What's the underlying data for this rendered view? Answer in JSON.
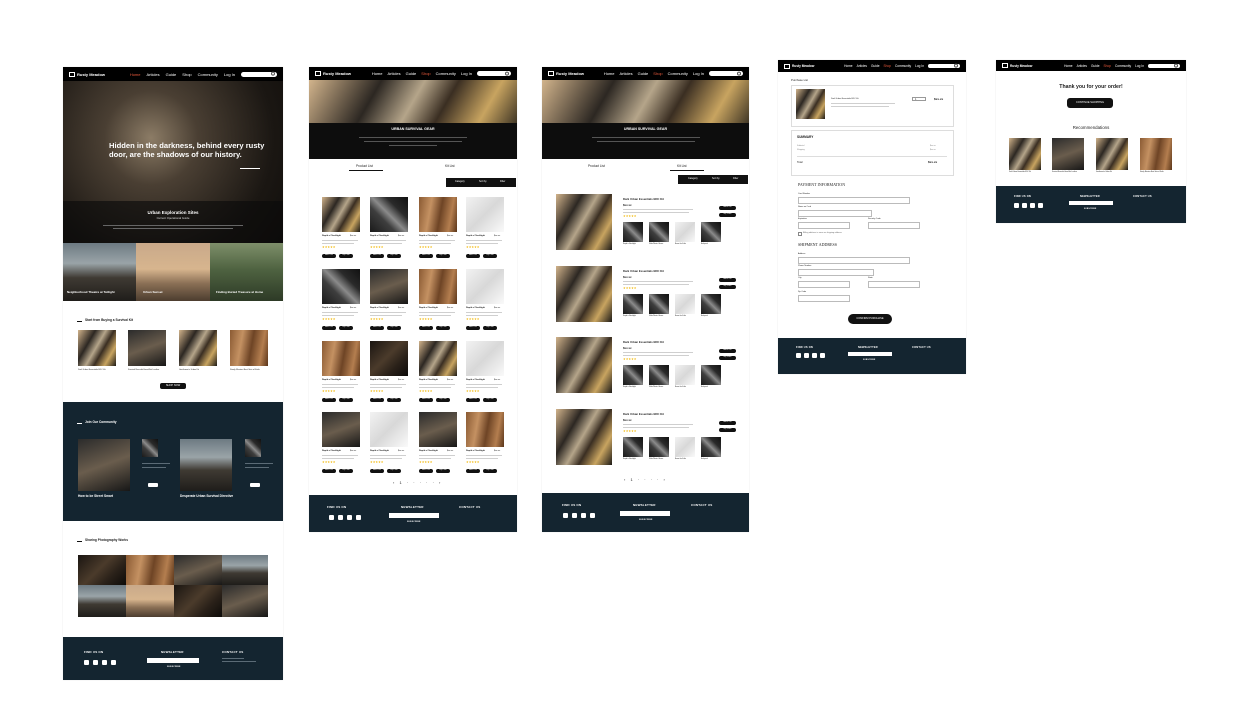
{
  "brand": "Rusty Meadow",
  "nav": [
    "Home",
    "Articles",
    "Guide",
    "Shop",
    "Community",
    "Log In"
  ],
  "home": {
    "hero_text": "Hidden in the darkness, behind every rusty door, are the shadows of our history.",
    "explore_title": "Urban Exploration Sites",
    "explore_sub": "Current Operational Guide",
    "cards": [
      "Neighborhood Theatre at Twilight",
      "Urban Sunset",
      "Finding Buried Treasure at Home"
    ],
    "survival_title": "Start from Buying a Survival Kit",
    "kits": [
      "Dark Urban Essentials EDC Kit",
      "Survival Bracelet Hand-Set Leather",
      "Gentleman's Urbex Kit",
      "Steely Masters Best Sets of Knife"
    ],
    "shop_now": "SHOP NOW",
    "community_title": "Join Our Community",
    "community_posts": [
      "How to be Street Smart",
      "Desperate Urban Survival Directive"
    ],
    "photo_title": "Sharing Photography Works"
  },
  "shop": {
    "banner_title": "URBAN SURVIVAL GEAR",
    "tabs": [
      "Product List",
      "Kit List"
    ],
    "filters": [
      "Category",
      "Sort by",
      "Filter"
    ],
    "product_name": "Rapid-x Flashlight",
    "product_price": "$xx.xx",
    "kit_name": "Dark Urban Essentials EDC Kit",
    "kit_price": "$xx.xx",
    "kit_items": [
      "Rapid-x Flashlight",
      "Glide Winter Gloves",
      "Brave the Knife",
      "Backpack"
    ],
    "add_to_cart": "Add to Cart",
    "buy_now": "Buy It Now"
  },
  "checkout": {
    "purchase_list": "Purchase List",
    "item": "Dark Urban Essentials EDC Kit",
    "qty": "1",
    "price": "$xx.xx",
    "summary": "SUMMARY",
    "subtotal": "Subtotal",
    "shipping": "Shipping",
    "total": "Total",
    "payment_title": "PAYMENT INFORMATION",
    "fields_pay": [
      "Card Number",
      "Name on Card",
      "Expiration",
      "Security Code"
    ],
    "billing_same": "Billing address is same as shipping address",
    "shipment_title": "SHIPMENT ADDRESS",
    "fields_ship": [
      "Address",
      "Phone Number",
      "City",
      "State",
      "Zip Code"
    ],
    "confirm": "CONFIRM PURCHASE"
  },
  "thanks": {
    "title": "Thank you for your order!",
    "continue": "CONTINUE SHOPPING",
    "recs_title": "Recommendations"
  },
  "footer": {
    "find": "FIND US ON",
    "newsletter": "NEWSLETTER",
    "subscribe": "SUBSCRIBE",
    "contact": "CONTACT US"
  }
}
